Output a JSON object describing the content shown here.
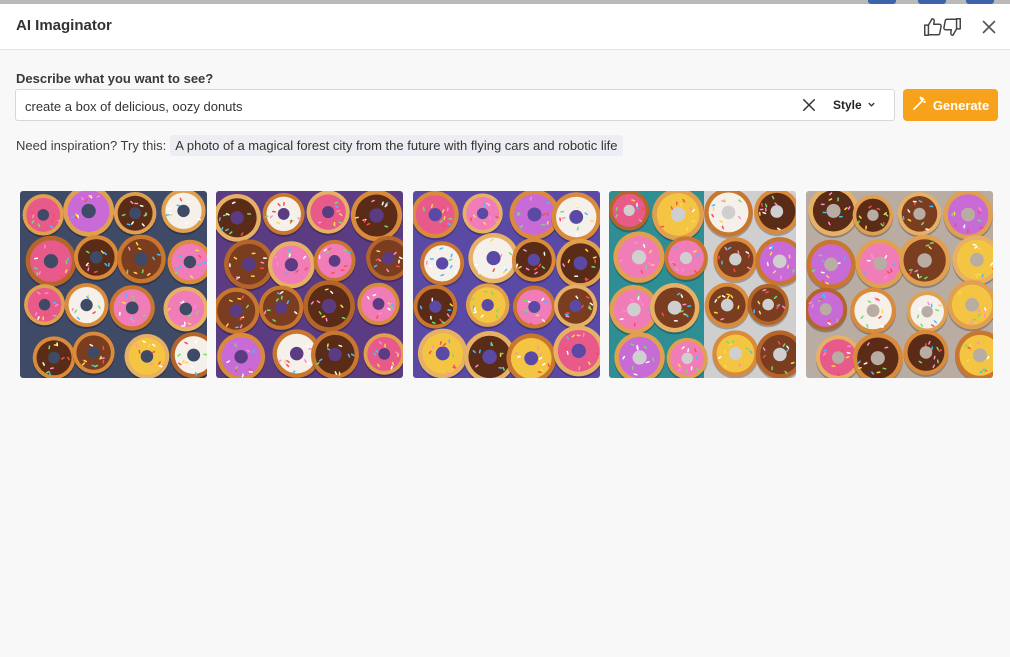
{
  "window": {
    "title": "AI Imaginator"
  },
  "header": {
    "feedback_icons": [
      "thumbs-up-icon",
      "thumbs-down-icon"
    ],
    "close_icon": "close-icon"
  },
  "prompt": {
    "label": "Describe what you want to see?",
    "value": "create a box of delicious, oozy donuts",
    "clear_icon": "clear-icon",
    "style_label": "Style"
  },
  "generate": {
    "label": "Generate",
    "color": "#f7a21b",
    "icon": "magic-wand-icon"
  },
  "inspiration": {
    "label": "Need inspiration? Try this:",
    "suggestion": "A photo of a magical forest city from the future with flying cars and robotic life"
  },
  "images": [
    {
      "name": "donut-image-1",
      "background": "#3f4a67"
    },
    {
      "name": "donut-image-2",
      "background": "#5b3c82"
    },
    {
      "name": "donut-image-3",
      "background": "#5a4aa6"
    },
    {
      "name": "donut-image-4",
      "background": "#cfcfcf"
    },
    {
      "name": "donut-image-5",
      "background": "#b9aca3"
    }
  ]
}
